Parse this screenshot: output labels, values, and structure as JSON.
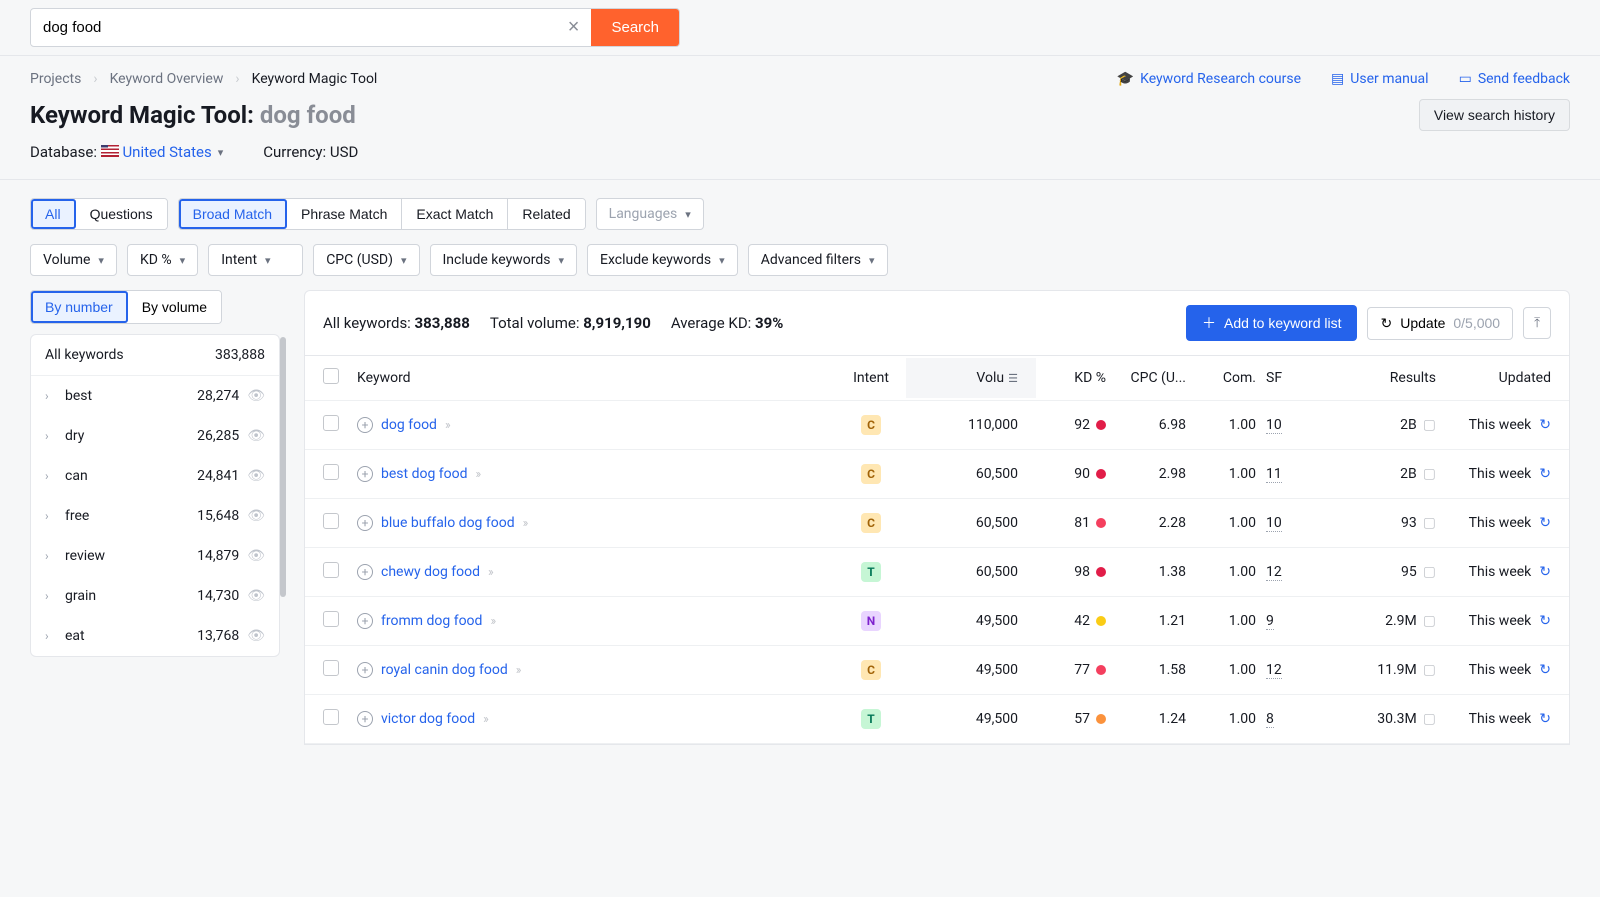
{
  "search": {
    "value": "dog food",
    "button": "Search"
  },
  "breadcrumb": {
    "projects": "Projects",
    "overview": "Keyword Overview",
    "current": "Keyword Magic Tool"
  },
  "header_links": {
    "course": "Keyword Research course",
    "manual": "User manual",
    "feedback": "Send feedback"
  },
  "title_prefix": "Keyword Magic Tool:",
  "title_kw": "dog food",
  "history_btn": "View search history",
  "db_label": "Database:",
  "db_value": "United States",
  "cur_label": "Currency: USD",
  "tabs1": {
    "all": "All",
    "questions": "Questions"
  },
  "tabs2": {
    "broad": "Broad Match",
    "phrase": "Phrase Match",
    "exact": "Exact Match",
    "related": "Related"
  },
  "languages": "Languages",
  "filters": {
    "volume": "Volume",
    "kd": "KD %",
    "intent": "Intent",
    "cpc": "CPC (USD)",
    "include": "Include keywords",
    "exclude": "Exclude keywords",
    "advanced": "Advanced filters"
  },
  "sort": {
    "number": "By number",
    "volume": "By volume"
  },
  "side_header": {
    "label": "All keywords",
    "count": "383,888"
  },
  "side_items": [
    {
      "label": "best",
      "count": "28,274"
    },
    {
      "label": "dry",
      "count": "26,285"
    },
    {
      "label": "can",
      "count": "24,841"
    },
    {
      "label": "free",
      "count": "15,648"
    },
    {
      "label": "review",
      "count": "14,879"
    },
    {
      "label": "grain",
      "count": "14,730"
    },
    {
      "label": "eat",
      "count": "13,768"
    }
  ],
  "stats": {
    "all_label": "All keywords: ",
    "all": "383,888",
    "vol_label": "Total volume: ",
    "vol": "8,919,190",
    "kd_label": "Average KD: ",
    "kd": "39%"
  },
  "actions": {
    "add": "Add to keyword list",
    "update": "Update",
    "count": "0/5,000"
  },
  "columns": {
    "kw": "Keyword",
    "intent": "Intent",
    "vol": "Volu",
    "kd": "KD %",
    "cpc": "CPC (U...",
    "com": "Com.",
    "sf": "SF",
    "res": "Results",
    "upd": "Updated"
  },
  "rows": [
    {
      "kw": "dog food",
      "intent": "C",
      "vol": "110,000",
      "kd": "92",
      "kdc": "#e11d48",
      "cpc": "6.98",
      "com": "1.00",
      "sf": "10",
      "res": "2B",
      "upd": "This week"
    },
    {
      "kw": "best dog food",
      "intent": "C",
      "vol": "60,500",
      "kd": "90",
      "kdc": "#e11d48",
      "cpc": "2.98",
      "com": "1.00",
      "sf": "11",
      "res": "2B",
      "upd": "This week"
    },
    {
      "kw": "blue buffalo dog food",
      "intent": "C",
      "vol": "60,500",
      "kd": "81",
      "kdc": "#f43f5e",
      "cpc": "2.28",
      "com": "1.00",
      "sf": "10",
      "res": "93",
      "upd": "This week"
    },
    {
      "kw": "chewy dog food",
      "intent": "T",
      "vol": "60,500",
      "kd": "98",
      "kdc": "#e11d48",
      "cpc": "1.38",
      "com": "1.00",
      "sf": "12",
      "res": "95",
      "upd": "This week"
    },
    {
      "kw": "fromm dog food",
      "intent": "N",
      "vol": "49,500",
      "kd": "42",
      "kdc": "#facc15",
      "cpc": "1.21",
      "com": "1.00",
      "sf": "9",
      "res": "2.9M",
      "upd": "This week"
    },
    {
      "kw": "royal canin dog food",
      "intent": "C",
      "vol": "49,500",
      "kd": "77",
      "kdc": "#f43f5e",
      "cpc": "1.58",
      "com": "1.00",
      "sf": "12",
      "res": "11.9M",
      "upd": "This week"
    },
    {
      "kw": "victor dog food",
      "intent": "T",
      "vol": "49,500",
      "kd": "57",
      "kdc": "#fb923c",
      "cpc": "1.24",
      "com": "1.00",
      "sf": "8",
      "res": "30.3M",
      "upd": "This week"
    }
  ]
}
